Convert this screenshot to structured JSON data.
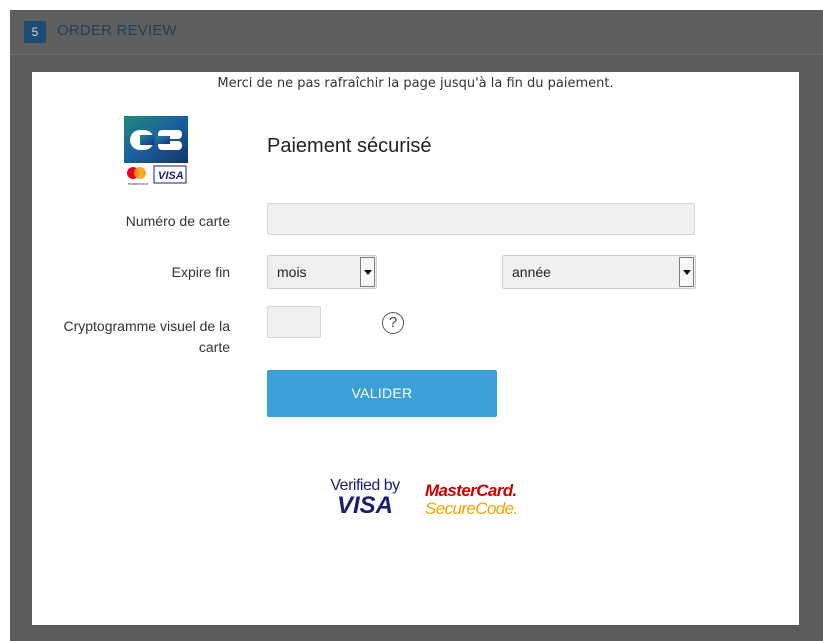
{
  "step": {
    "number": "5",
    "title": "ORDER REVIEW"
  },
  "payment": {
    "notice": "Merci de ne pas rafraîchir la page jusqu'à la fin du paiement.",
    "title": "Paiement sécurisé",
    "logo_text": "mastercard",
    "card_brand_visa": "VISA",
    "card_number_label": "Numéro de carte",
    "card_number_value": "",
    "expiry_label": "Expire fin",
    "month_select": "mois",
    "year_select": "année",
    "cvv_label_line1": "Cryptogramme visuel de la",
    "cvv_label_line2": "carte",
    "cvv_value": "",
    "help_symbol": "?",
    "submit_label": "VALIDER"
  },
  "badges": {
    "vbv_line1": "Verified by",
    "vbv_line2": "VISA",
    "mc_line1": "MasterCard.",
    "mc_line2": "SecureCode."
  },
  "colors": {
    "backdrop": "#5b5b5b",
    "step_badge": "#1e4b73",
    "button": "#3aa0d6"
  }
}
